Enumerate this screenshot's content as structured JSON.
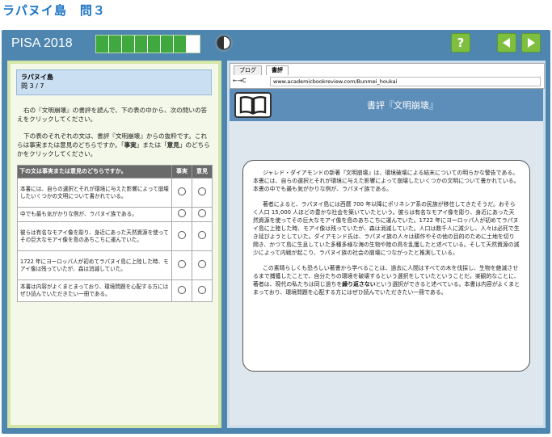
{
  "page_heading": "ラパヌイ島　問３",
  "topbar": {
    "pisa_label": "PISA 2018",
    "progress": {
      "total_segments": 8,
      "current_segment": 8
    },
    "help_label": "?",
    "icons": {
      "timer": "pie-timer-icon",
      "prev": "triangle-left-icon",
      "next": "triangle-right-icon"
    }
  },
  "left": {
    "title": "ラパヌイ島",
    "counter": "問 3 / 7",
    "instruction1": "右の『文明崩壊』の書評を読んで、下の表の中から、次の問いの答えをクリックしてください。",
    "instruction2_part1": "下の表のそれぞれの文は、書評『文明崩壊』からの抜粋です。これらは事実または意見のどちらですか。「",
    "instruction2_bold1": "事実",
    "instruction2_part2": "」または「",
    "instruction2_bold2": "意見",
    "instruction2_part3": "」のどちらかをクリックしてください。",
    "table": {
      "headers": [
        "下の文は事実または意見のどちらですか。",
        "事実",
        "意見"
      ],
      "rows": [
        "本書には、自らの選択とそれが環境に与えた影響によって崩壊したいくつかの文明について書かれている。",
        "中でも最も気がかりな例が、ラパヌイ族である。",
        "彼らは有名なモアイ像を彫り、身近にあった天然資源を使ってその巨大なモアイ像を島のあちこちに運んでいた。",
        "1722 年にヨーロッパ人が初めてラパヌイ島に上陸した時、モアイ像は残っていたが、森は消滅していた。",
        "本書は内容がよくまとまっており、環境問題を心配する方にはぜひ読んでいただきたい一冊である。"
      ]
    }
  },
  "browser": {
    "tabs": [
      "ブログ",
      "書評"
    ],
    "active_tab": 1,
    "nav": "←→C",
    "url": "www.academicbookreview.com/Bunmei_houkai"
  },
  "review": {
    "title": "書評『文明崩壊』",
    "icon": "open-book-icon",
    "para1": "ジャレド・ダイアモンドの新著『文明崩壊』は、環境破壊による結末についての明らかな警告である。本書には、自らの選択とそれが環境に与えた影響によって崩壊したいくつかの文明について書かれている。本書の中でも最も気がかりな例が、ラパヌイ族である。",
    "para2": "著者によると、ラパヌイ島には西暦 700 年以降にポリネシア系の民族が移住してきたそうだ。おそらく人口 15,000 人ほどの豊かな社会を築いていたという。彼らは有名なモアイ像を彫り、身近にあった天然資源を使ってその巨大なモアイ像を島のあちこちに運んでいた。1722 年にヨーロッパ人が初めてラパヌイ島に上陸した時、モアイ像は残っていたが、森は消滅していた。人口は数千人に減少し、人々は必死で生き延びようとしていた。ダイアモンド氏は、ラパヌイ族の人々は耕作やその他の目的のために土地を切り開き、かつて島に生息していた多種多様な海の生物や陸の鳥を乱獲したと述べている。そして天然資源の減少によって内戦が起こり、ラパヌイ族の社会の崩壊につながったと推測している。",
    "para3_part1": "この素晴らしくも恐ろしい著書から学べることは、過去に人間はすべての木を伐採し、生物を絶滅させるまで捕獲したことで、自分たちの環境を破壊するという選択をしていたということだ。楽観的なことに、著者は、現代の私たちは同じ過ちを",
    "para3_bold": "繰り返さない",
    "para3_part2": "という選択ができると述べている。本書は内容がよくまとまっており、環境問題を心配する方にはぜひ読んでいただきたい一冊である。"
  }
}
